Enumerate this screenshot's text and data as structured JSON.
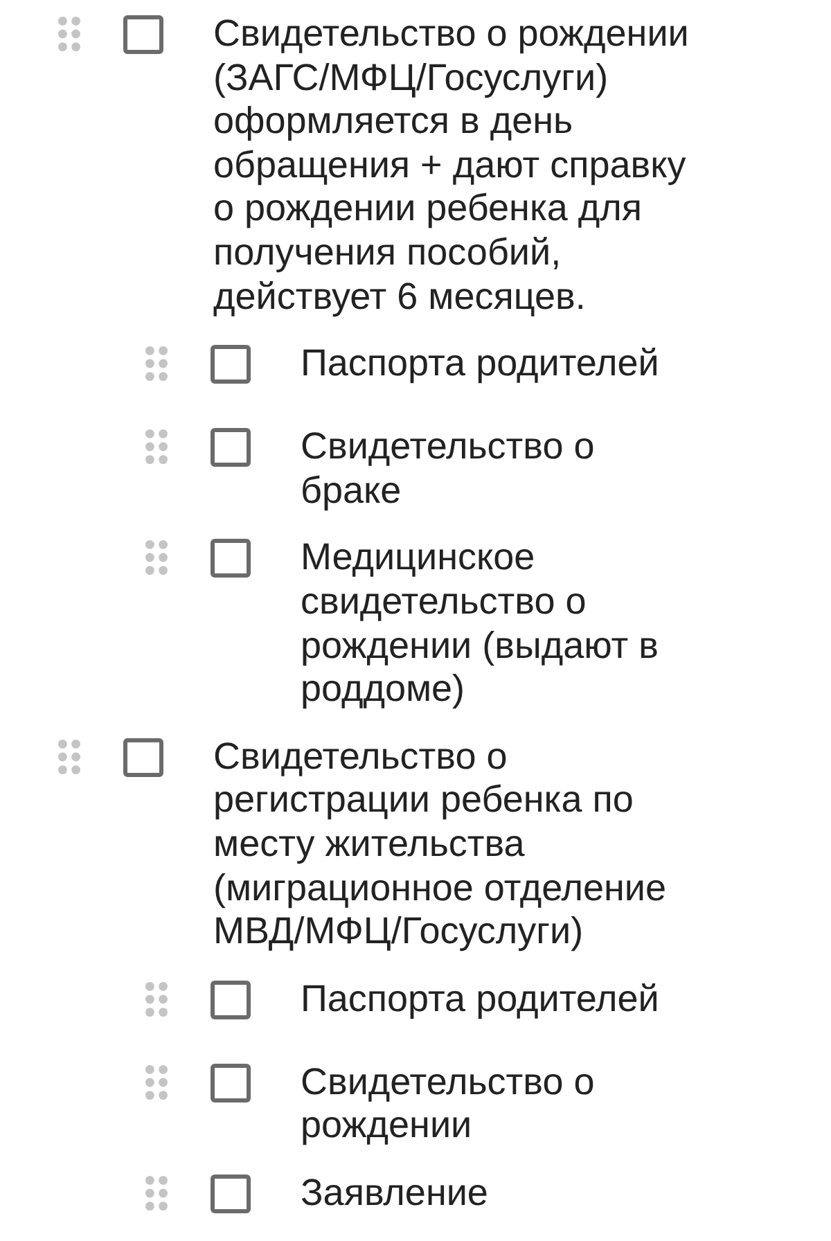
{
  "checklist": {
    "items": [
      {
        "text": "Свидетельство о рождении (ЗАГС/МФЦ/Госуслуги) оформляется в день обращения + дают справку о рождении ребенка для получения пособий, действует 6 месяцев.",
        "checked": false,
        "children": [
          {
            "text": "Паспорта родителей",
            "checked": false
          },
          {
            "text": "Свидетельство о браке",
            "checked": false
          },
          {
            "text": "Медицинское свидетельство о рождении (выдают в роддоме)",
            "checked": false
          }
        ]
      },
      {
        "text": "Свидетельство о регистрации ребенка по месту жительства (миграционное отделение МВД/МФЦ/Госуслуги)",
        "checked": false,
        "children": [
          {
            "text": "Паспорта родителей",
            "checked": false
          },
          {
            "text": "Свидетельство о рождении",
            "checked": false
          },
          {
            "text": "Заявление",
            "checked": false
          }
        ]
      }
    ]
  }
}
